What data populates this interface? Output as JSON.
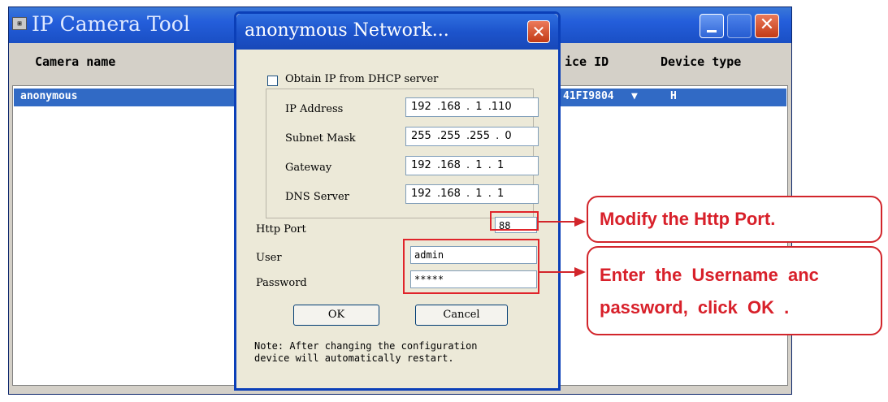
{
  "main_window": {
    "title": "IP Camera Tool",
    "app_icon": "camera-app-icon",
    "columns": [
      "Camera name",
      "ice ID",
      "Device type"
    ],
    "rows": [
      {
        "name": "anonymous",
        "device_id": "41FI9804",
        "device_type": "H"
      }
    ]
  },
  "dialog": {
    "title": "anonymous Network...",
    "dhcp_checkbox": {
      "label": "Obtain IP from DHCP server",
      "checked": false
    },
    "fields": {
      "ip_address": {
        "label": "IP Address",
        "value": "192 .168 . 1 .110"
      },
      "subnet_mask": {
        "label": "Subnet Mask",
        "value": "255 .255 .255 . 0"
      },
      "gateway": {
        "label": "Gateway",
        "value": "192 .168 . 1 . 1"
      },
      "dns_server": {
        "label": "DNS Server",
        "value": "192 .168 . 1 . 1"
      }
    },
    "http_port": {
      "label": "Http Port",
      "value": "88"
    },
    "user": {
      "label": "User",
      "value": "admin"
    },
    "password": {
      "label": "Password",
      "value": "*****"
    },
    "ok_label": "OK",
    "cancel_label": "Cancel",
    "note_line1": "Note: After changing the configuration",
    "note_line2": "device will automatically restart."
  },
  "callouts": {
    "port": "Modify the Http Port.",
    "credentials_line1": "Enter the Username anc",
    "credentials_line2": "password, click OK ."
  },
  "colors": {
    "accent_red": "#d2252b",
    "titlebar_blue": "#245edb",
    "selection_blue": "#316ac5"
  }
}
